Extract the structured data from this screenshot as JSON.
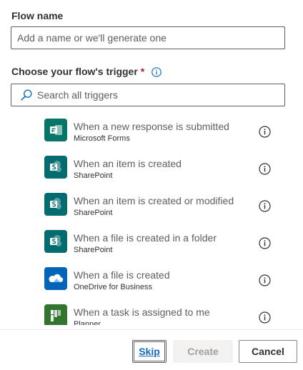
{
  "flow_name": {
    "label": "Flow name",
    "placeholder": "Add a name or we'll generate one",
    "value": ""
  },
  "trigger": {
    "label": "Choose your flow's trigger",
    "required_marker": "*",
    "search_placeholder": "Search all triggers"
  },
  "triggers": [
    {
      "title": "When a new response is submitted",
      "app": "Microsoft Forms",
      "icon": "forms-icon",
      "color": "#077568"
    },
    {
      "title": "When an item is created",
      "app": "SharePoint",
      "icon": "sharepoint-icon",
      "color": "#036C70"
    },
    {
      "title": "When an item is created or modified",
      "app": "SharePoint",
      "icon": "sharepoint-icon",
      "color": "#036C70"
    },
    {
      "title": "When a file is created in a folder",
      "app": "SharePoint",
      "icon": "sharepoint-icon",
      "color": "#036C70"
    },
    {
      "title": "When a file is created",
      "app": "OneDrive for Business",
      "icon": "onedrive-icon",
      "color": "#0364B8"
    },
    {
      "title": "When a task is assigned to me",
      "app": "Planner",
      "icon": "planner-icon",
      "color": "#31752F"
    }
  ],
  "buttons": {
    "skip": "Skip",
    "create": "Create",
    "cancel": "Cancel"
  }
}
